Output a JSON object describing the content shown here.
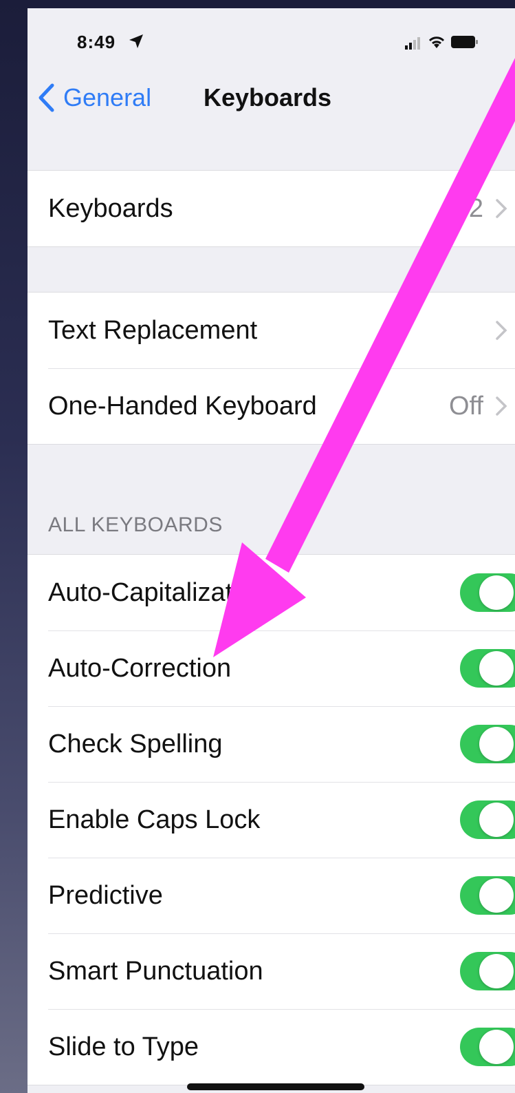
{
  "status_bar": {
    "time": "8:49"
  },
  "nav": {
    "back_label": "General",
    "title": "Keyboards"
  },
  "group1": {
    "keyboards_label": "Keyboards",
    "keyboards_value": "2"
  },
  "group2": {
    "text_replacement_label": "Text Replacement",
    "one_handed_label": "One-Handed Keyboard",
    "one_handed_value": "Off"
  },
  "all_keyboards": {
    "header": "ALL KEYBOARDS",
    "toggles": [
      {
        "label": "Auto-Capitalization",
        "on": true
      },
      {
        "label": "Auto-Correction",
        "on": true
      },
      {
        "label": "Check Spelling",
        "on": true
      },
      {
        "label": "Enable Caps Lock",
        "on": true
      },
      {
        "label": "Predictive",
        "on": true
      },
      {
        "label": "Smart Punctuation",
        "on": true
      },
      {
        "label": "Slide to Type",
        "on": true
      }
    ]
  },
  "colors": {
    "accent": "#2f7cf6",
    "toggle_on": "#34c759",
    "annotation": "#ff3bef"
  }
}
